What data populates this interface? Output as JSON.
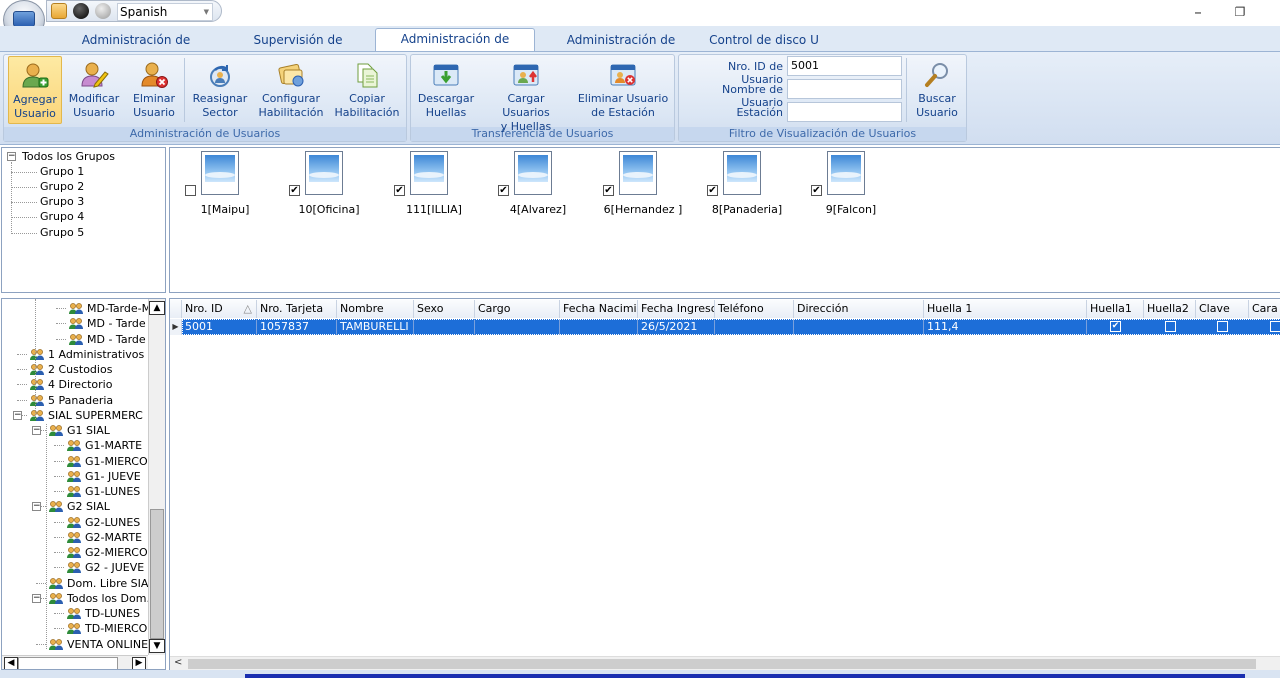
{
  "quick_access": {
    "language": "Spanish"
  },
  "tabs": [
    {
      "label": "Administración de dispositivo"
    },
    {
      "label": "Supervisión de Registros"
    },
    {
      "label": "Administración de Usuarios"
    },
    {
      "label": "Administración de Registros"
    },
    {
      "label": "Control de disco U"
    }
  ],
  "ribbon": {
    "group_users": {
      "label": "Administración de Usuarios",
      "buttons": [
        {
          "line1": "Agregar",
          "line2": "Usuario"
        },
        {
          "line1": "Modificar",
          "line2": "Usuario"
        },
        {
          "line1": "Elminar",
          "line2": "Usuario"
        },
        {
          "line1": "Reasignar",
          "line2": "Sector"
        },
        {
          "line1": "Configurar",
          "line2": "Habilitación"
        },
        {
          "line1": "Copiar",
          "line2": "Habilitación"
        }
      ]
    },
    "group_transfer": {
      "label": "Transferencia de Usuarios",
      "buttons": [
        {
          "line1": "Descargar",
          "line2": "Huellas"
        },
        {
          "line1": "Cargar Usuarios",
          "line2": "y Huellas"
        },
        {
          "line1": "Eliminar Usuario",
          "line2": "de Estación"
        }
      ]
    },
    "group_filter": {
      "label": "Filtro de Visualización de Usuarios",
      "id_label": "Nro. ID de Usuario",
      "id_value": "5001",
      "name_label": "Nombre de Usuario",
      "name_value": "",
      "station_label": "Estación",
      "station_value": "",
      "search": {
        "line1": "Buscar",
        "line2": "Usuario"
      }
    }
  },
  "group_tree": {
    "root": "Todos los Grupos",
    "items": [
      "Grupo 1",
      "Grupo 2",
      "Grupo 3",
      "Grupo 4",
      "Grupo 5"
    ]
  },
  "stations": [
    {
      "label": "1[Maipu]",
      "checked": false
    },
    {
      "label": "10[Oficina]",
      "checked": true
    },
    {
      "label": "111[ILLIA]",
      "checked": true
    },
    {
      "label": "4[Alvarez]",
      "checked": true
    },
    {
      "label": "6[Hernandez ]",
      "checked": true
    },
    {
      "label": "8[Panaderia]",
      "checked": true
    },
    {
      "label": "9[Falcon]",
      "checked": true
    }
  ],
  "dept_tree": [
    {
      "label": "MD-Tarde-M"
    },
    {
      "label": "MD - Tarde"
    },
    {
      "label": "MD - Tarde"
    },
    {
      "label": "1 Administrativos"
    },
    {
      "label": "2 Custodios"
    },
    {
      "label": "4 Directorio"
    },
    {
      "label": "5 Panaderia"
    },
    {
      "label": "SIAL SUPERMERC"
    },
    {
      "label": "G1 SIAL"
    },
    {
      "label": "G1-MARTE"
    },
    {
      "label": "G1-MIERCO"
    },
    {
      "label": "G1- JUEVE"
    },
    {
      "label": "G1-LUNES"
    },
    {
      "label": "G2 SIAL"
    },
    {
      "label": "G2-LUNES"
    },
    {
      "label": "G2-MARTE"
    },
    {
      "label": "G2-MIERCO"
    },
    {
      "label": "G2 - JUEVE"
    },
    {
      "label": "Dom. Libre SIAL"
    },
    {
      "label": "Todos los Dom."
    },
    {
      "label": "TD-LUNES"
    },
    {
      "label": "TD-MIERCO"
    },
    {
      "label": "VENTA ONLINE"
    }
  ],
  "grid": {
    "columns": [
      "Nro. ID",
      "Nro. Tarjeta",
      "Nombre",
      "Sexo",
      "Cargo",
      "Fecha Nacimier",
      "Fecha Ingreso",
      "Teléfono",
      "Dirección",
      "Huella 1",
      "Huella1",
      "Huella2",
      "Clave",
      "Cara"
    ],
    "sort_glyph": "△",
    "row": {
      "id": "5001",
      "card": "1057837",
      "name": "TAMBURELLI (",
      "sex": "",
      "position": "",
      "birth": "",
      "hire": "26/5/2021",
      "phone": "",
      "address": "",
      "fp1": "111,4",
      "huella1": true,
      "huella2": false,
      "clave": false,
      "cara": false
    }
  },
  "colors": {
    "selection": "#1d6ed8",
    "accent": "#15428b",
    "ribbon": "#dbe6f4"
  },
  "icons": [
    "app-orb-icon",
    "add-user-icon",
    "edit-user-icon",
    "delete-user-icon",
    "reassign-icon",
    "config-icon",
    "copy-icon",
    "download-icon",
    "upload-icon",
    "remove-device-icon",
    "search-icon",
    "user-group-icon"
  ]
}
